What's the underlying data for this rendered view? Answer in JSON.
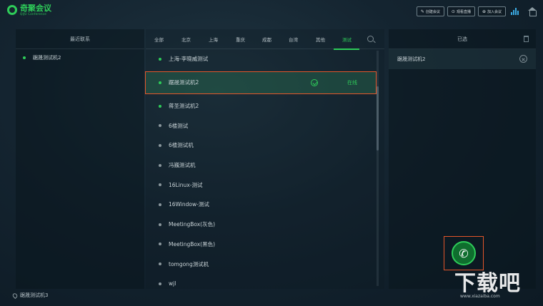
{
  "app": {
    "name": "奇聚会议",
    "subtitle": "QIJU Conference"
  },
  "topbar": {
    "create_meeting": "创建会议",
    "live": "观看直播",
    "join_meeting": "加入会议"
  },
  "left_panel": {
    "title": "最近联系",
    "items": [
      {
        "label": "踞晟测试机2"
      }
    ]
  },
  "tabs": [
    {
      "label": "全部"
    },
    {
      "label": "北京"
    },
    {
      "label": "上海"
    },
    {
      "label": "重庆"
    },
    {
      "label": "成都"
    },
    {
      "label": "台湾"
    },
    {
      "label": "其他"
    },
    {
      "label": "测试",
      "active": true
    }
  ],
  "contacts": [
    {
      "label": "上海-李晓威测试",
      "online": true
    },
    {
      "label": "踞晟测试机2",
      "online": true,
      "selected": true,
      "status": "在线"
    },
    {
      "label": "蒋圣测试机2",
      "online": true
    },
    {
      "label": "6楼测试",
      "online": false
    },
    {
      "label": "6楼测试机",
      "online": false
    },
    {
      "label": "冯巍测试机",
      "online": false
    },
    {
      "label": "16Linux-测试",
      "online": false
    },
    {
      "label": "16Window-测试",
      "online": false
    },
    {
      "label": "MeetingBox(灰色)",
      "online": false
    },
    {
      "label": "MeetingBox(黑色)",
      "online": false
    },
    {
      "label": "tomgong测试机",
      "online": false
    },
    {
      "label": "wjl",
      "online": false
    }
  ],
  "right_panel": {
    "title": "已选",
    "items": [
      {
        "label": "踞晟测试机2"
      }
    ]
  },
  "status_bar": {
    "user": "踞晟测试机3"
  },
  "watermark": {
    "text": "下载吧",
    "url": "www.xiazaiba.com"
  },
  "colors": {
    "accent": "#2ecc59",
    "highlight_border": "#e4562a"
  }
}
